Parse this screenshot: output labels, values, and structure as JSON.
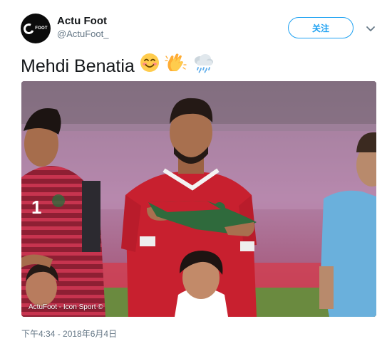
{
  "tweet": {
    "author_name": "Actu Foot",
    "author_handle": "@ActuFoot_",
    "avatar_text": "FOOT",
    "follow_label": "关注",
    "text": "Mehdi Benatia",
    "emojis": [
      "smiling-face-emoji",
      "clapping-hands-emoji",
      "cloud-with-rain-emoji"
    ],
    "photo_credit": "ActuFoot - Icon Sport ©",
    "timestamp": "下午4:34 - 2018年6月4日",
    "jersey_number": "1"
  },
  "colors": {
    "accent": "#1da1f2",
    "muted": "#657786",
    "text": "#14171a",
    "jersey_red": "#c8202f",
    "goalkeeper_stripes": "#b0233a",
    "referee_blue": "#6ab0dc"
  }
}
